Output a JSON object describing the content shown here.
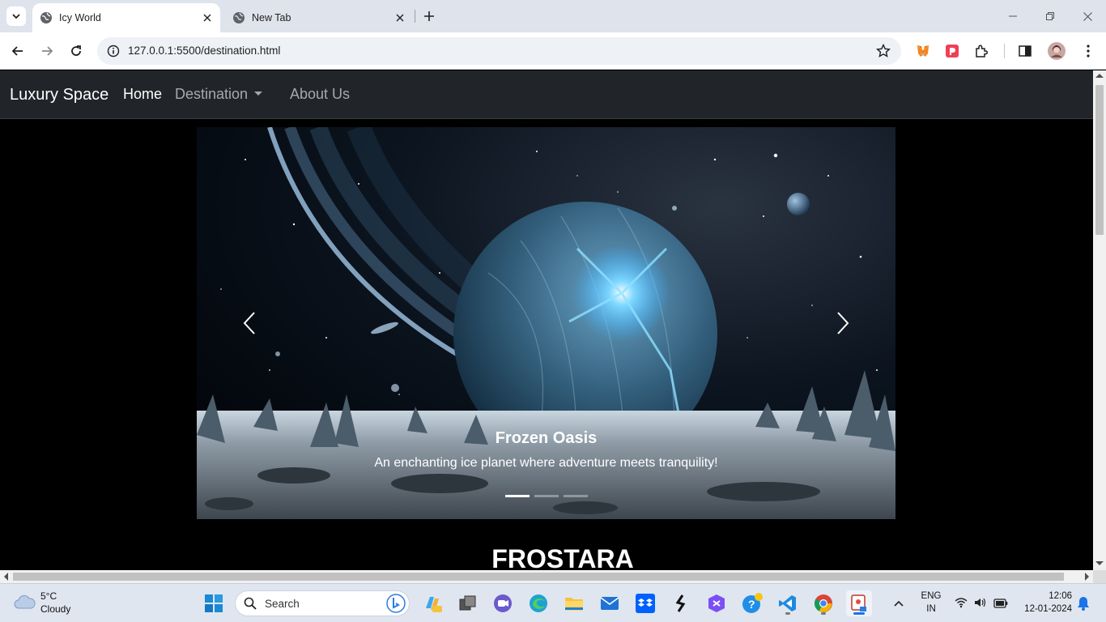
{
  "browser": {
    "tabs": [
      {
        "title": "Icy World",
        "active": true
      },
      {
        "title": "New Tab",
        "active": false
      }
    ],
    "url": "127.0.0.1:5500/destination.html"
  },
  "site": {
    "brand": "Luxury Space",
    "nav": {
      "home": "Home",
      "destination": "Destination",
      "about": "About Us"
    },
    "carousel": {
      "slide_title": "Frozen Oasis",
      "slide_text": "An enchanting ice planet where adventure meets tranquility!",
      "indicator_count": 3,
      "active_indicator": 1
    },
    "heading": "FROSTARA"
  },
  "taskbar": {
    "weather_temp": "5°C",
    "weather_desc": "Cloudy",
    "search_placeholder": "Search",
    "lang_top": "ENG",
    "lang_bottom": "IN",
    "time": "12:06",
    "date": "12-01-2024"
  },
  "colors": {
    "navbar_bg": "#212529",
    "page_bg": "#000000",
    "tabstrip_bg": "#dfe3eb",
    "taskbar_bg": "#dfe6ef"
  }
}
